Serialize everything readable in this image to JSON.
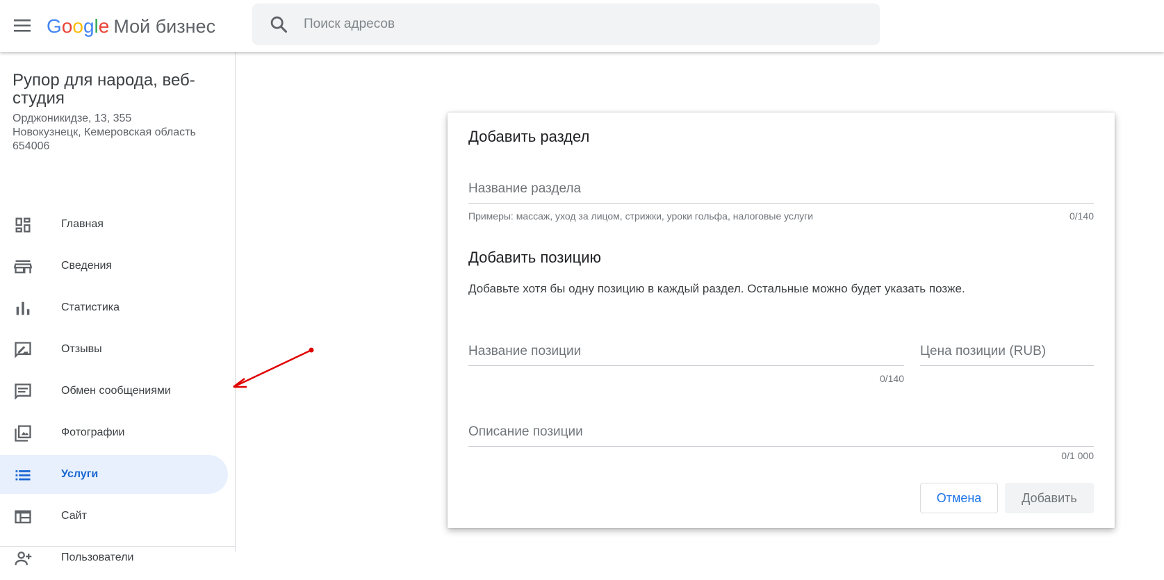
{
  "header": {
    "logo_letters": [
      "G",
      "o",
      "o",
      "g",
      "l",
      "e"
    ],
    "product_name": "Мой бизнес",
    "search_placeholder": "Поиск адресов",
    "menu_icon": "hamburger-menu-icon",
    "search_icon": "search-icon"
  },
  "business": {
    "name": "Рупор для народа, веб-студия",
    "address_line1": "Орджоникидзе, 13, 355",
    "address_line2": "Новокузнецк, Кемеровская область",
    "address_line3": "654006"
  },
  "nav": {
    "items": [
      {
        "label": "Главная",
        "icon": "dashboard-icon"
      },
      {
        "label": "Сведения",
        "icon": "storefront-icon"
      },
      {
        "label": "Статистика",
        "icon": "bar-chart-icon"
      },
      {
        "label": "Отзывы",
        "icon": "rate-review-icon"
      },
      {
        "label": "Обмен сообщениями",
        "icon": "message-icon"
      },
      {
        "label": "Фотографии",
        "icon": "photo-library-icon"
      },
      {
        "label": "Услуги",
        "icon": "list-icon",
        "active": true
      },
      {
        "label": "Сайт",
        "icon": "web-icon"
      },
      {
        "label": "Пользователи",
        "icon": "person-add-icon"
      }
    ]
  },
  "dialog": {
    "title": "Добавить раздел",
    "section_name_placeholder": "Название раздела",
    "section_name_value": "",
    "section_hint": "Примеры: массаж, уход за лицом, стрижки, уроки гольфа, налоговые услуги",
    "section_counter": "0/140",
    "item_title": "Добавить позицию",
    "item_desc": "Добавьте хотя бы одну позицию в каждый раздел. Остальные можно будет указать позже.",
    "item_name_placeholder": "Название позиции",
    "item_name_counter": "0/140",
    "item_price_placeholder": "Цена позиции (RUB)",
    "item_desc_placeholder": "Описание позиции",
    "item_desc_counter": "0/1 000",
    "cancel_label": "Отмена",
    "add_label": "Добавить"
  },
  "colors": {
    "accent_blue": "#1a73e8",
    "active_bg": "#e8f0fe",
    "annotation_red": "#e00000"
  }
}
